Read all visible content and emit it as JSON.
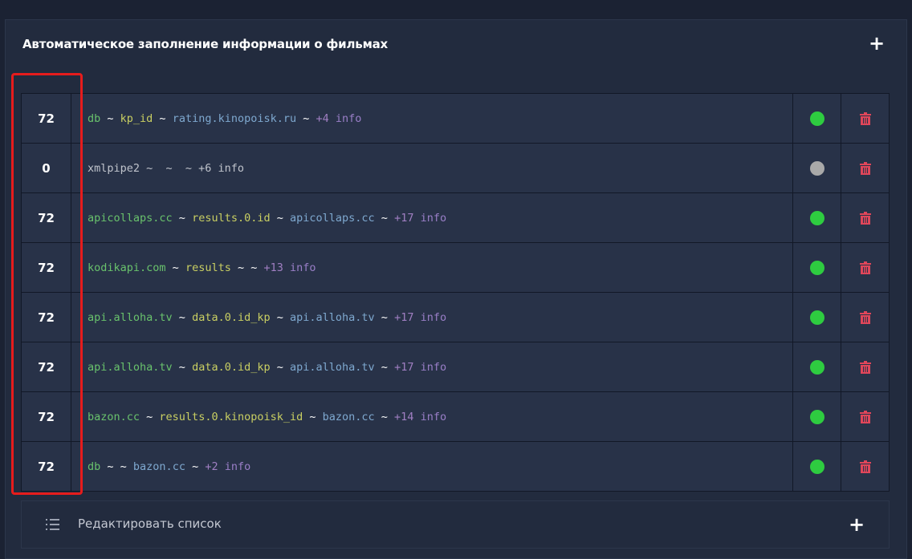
{
  "panel": {
    "title": "Автоматическое заполнение информации о фильмах",
    "add_icon": "+"
  },
  "colors": {
    "active": "#2ecc40",
    "inactive": "#a9a9a9",
    "trash": "#e0465a",
    "highlight": "#e61c1c"
  },
  "rows": [
    {
      "num": "72",
      "status": "active",
      "parts": [
        {
          "t": "db",
          "c": "src"
        },
        {
          "t": " ~ ",
          "c": "sep"
        },
        {
          "t": "kp_id",
          "c": "key"
        },
        {
          "t": " ~ ",
          "c": "sep"
        },
        {
          "t": "rating.kinopoisk.ru",
          "c": "tgt"
        },
        {
          "t": " ~ ",
          "c": "sep"
        },
        {
          "t": "+4",
          "c": "more"
        },
        {
          "t": " info",
          "c": "info"
        }
      ]
    },
    {
      "num": "0",
      "status": "inactive",
      "parts": [
        {
          "t": "xmlpipe2 ~  ~  ~ +6 info",
          "c": "grey"
        }
      ]
    },
    {
      "num": "72",
      "status": "active",
      "parts": [
        {
          "t": "apicollaps.cc",
          "c": "src"
        },
        {
          "t": " ~ ",
          "c": "sep"
        },
        {
          "t": "results.0.id",
          "c": "key"
        },
        {
          "t": " ~ ",
          "c": "sep"
        },
        {
          "t": "apicollaps.cc",
          "c": "tgt"
        },
        {
          "t": " ~ ",
          "c": "sep"
        },
        {
          "t": "+17",
          "c": "more"
        },
        {
          "t": " info",
          "c": "info"
        }
      ]
    },
    {
      "num": "72",
      "status": "active",
      "parts": [
        {
          "t": "kodikapi.com",
          "c": "src"
        },
        {
          "t": " ~ ",
          "c": "sep"
        },
        {
          "t": "results",
          "c": "key"
        },
        {
          "t": " ~ ",
          "c": "sep"
        },
        {
          "t": "~ ",
          "c": "sep"
        },
        {
          "t": "+13",
          "c": "more"
        },
        {
          "t": " info",
          "c": "info"
        }
      ]
    },
    {
      "num": "72",
      "status": "active",
      "parts": [
        {
          "t": "api.alloha.tv",
          "c": "src"
        },
        {
          "t": " ~ ",
          "c": "sep"
        },
        {
          "t": "data.0.id_kp",
          "c": "key"
        },
        {
          "t": " ~ ",
          "c": "sep"
        },
        {
          "t": "api.alloha.tv",
          "c": "tgt"
        },
        {
          "t": " ~ ",
          "c": "sep"
        },
        {
          "t": "+17",
          "c": "more"
        },
        {
          "t": " info",
          "c": "info"
        }
      ]
    },
    {
      "num": "72",
      "status": "active",
      "parts": [
        {
          "t": "api.alloha.tv",
          "c": "src"
        },
        {
          "t": " ~ ",
          "c": "sep"
        },
        {
          "t": "data.0.id_kp",
          "c": "key"
        },
        {
          "t": " ~ ",
          "c": "sep"
        },
        {
          "t": "api.alloha.tv",
          "c": "tgt"
        },
        {
          "t": " ~ ",
          "c": "sep"
        },
        {
          "t": "+17",
          "c": "more"
        },
        {
          "t": " info",
          "c": "info"
        }
      ]
    },
    {
      "num": "72",
      "status": "active",
      "parts": [
        {
          "t": "bazon.cc",
          "c": "src"
        },
        {
          "t": " ~ ",
          "c": "sep"
        },
        {
          "t": "results.0.kinopoisk_id",
          "c": "key"
        },
        {
          "t": " ~ ",
          "c": "sep"
        },
        {
          "t": "bazon.cc",
          "c": "tgt"
        },
        {
          "t": " ~ ",
          "c": "sep"
        },
        {
          "t": "+14",
          "c": "more"
        },
        {
          "t": " info",
          "c": "info"
        }
      ]
    },
    {
      "num": "72",
      "status": "active",
      "parts": [
        {
          "t": "db",
          "c": "src"
        },
        {
          "t": " ~ ",
          "c": "sep"
        },
        {
          "t": "~ ",
          "c": "sep"
        },
        {
          "t": "bazon.cc",
          "c": "tgt"
        },
        {
          "t": " ~ ",
          "c": "sep"
        },
        {
          "t": "+2",
          "c": "more"
        },
        {
          "t": " info",
          "c": "info"
        }
      ]
    }
  ],
  "footer": {
    "edit_label": "Редактировать список",
    "add_icon": "+"
  }
}
